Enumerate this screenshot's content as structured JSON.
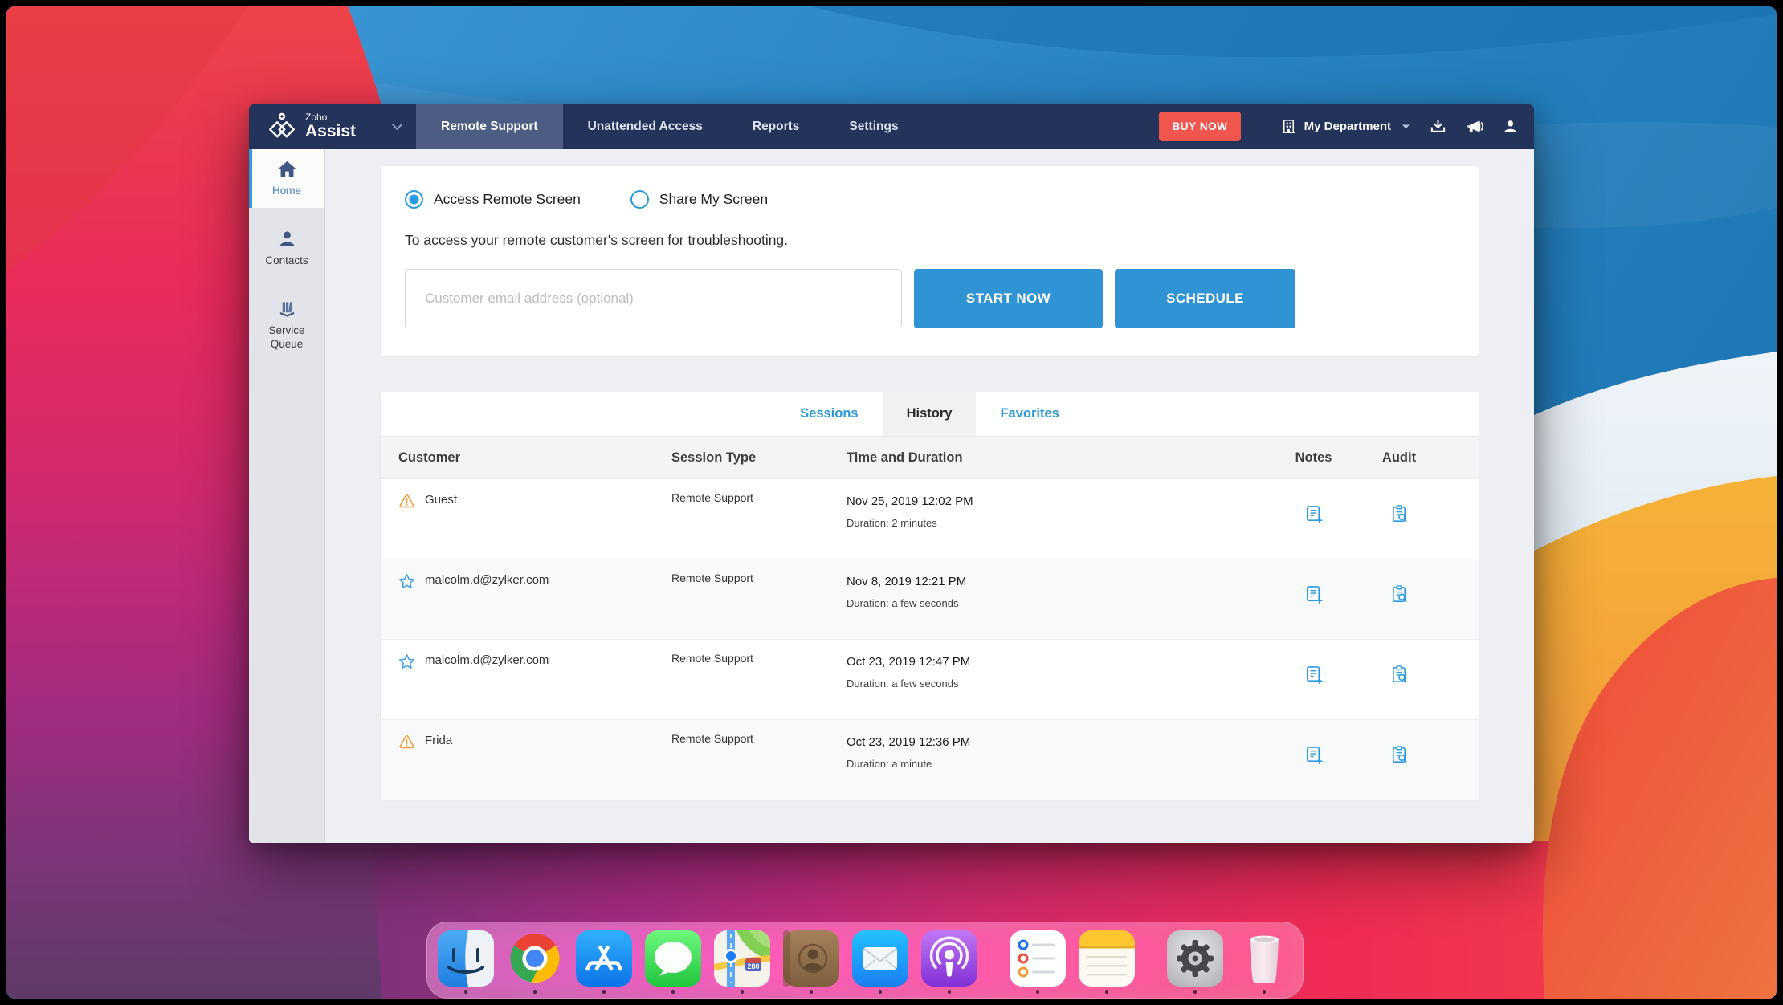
{
  "window": {
    "navbar": {
      "logo": {
        "zoho": "Zoho",
        "product": "Assist"
      },
      "tabs": [
        {
          "label": "Remote Support",
          "active": true
        },
        {
          "label": "Unattended Access",
          "active": false
        },
        {
          "label": "Reports",
          "active": false
        },
        {
          "label": "Settings",
          "active": false
        }
      ],
      "buy_now": "BUY NOW",
      "department": "My Department"
    },
    "sidebar": {
      "items": [
        {
          "label": "Home",
          "icon": "home-icon",
          "active": true
        },
        {
          "label": "Contacts",
          "icon": "contacts-icon",
          "active": false
        },
        {
          "label": "Service Queue",
          "icon": "service-queue-icon",
          "active": false
        }
      ]
    },
    "quick_action": {
      "radios": [
        {
          "label": "Access Remote Screen",
          "selected": true
        },
        {
          "label": "Share My Screen",
          "selected": false
        }
      ],
      "description": "To access your remote customer's screen for troubleshooting.",
      "email_placeholder": "Customer email address (optional)",
      "start_button": "START NOW",
      "schedule_button": "SCHEDULE"
    },
    "sessions": {
      "tabs": [
        {
          "label": "Sessions",
          "active": false
        },
        {
          "label": "History",
          "active": true
        },
        {
          "label": "Favorites",
          "active": false
        }
      ],
      "columns": [
        "Customer",
        "Session Type",
        "Time and Duration",
        "Notes",
        "Audit"
      ],
      "rows": [
        {
          "icon": "guest-alert-icon",
          "customer": "Guest",
          "session_type": "Remote Support",
          "time": "Nov 25, 2019 12:02 PM",
          "duration": "Duration: 2 minutes"
        },
        {
          "icon": "favorite-star-icon",
          "customer": "malcolm.d@zylker.com",
          "session_type": "Remote Support",
          "time": "Nov 8, 2019 12:21 PM",
          "duration": "Duration: a few seconds"
        },
        {
          "icon": "favorite-star-icon",
          "customer": "malcolm.d@zylker.com",
          "session_type": "Remote Support",
          "time": "Oct 23, 2019 12:47 PM",
          "duration": "Duration: a few seconds"
        },
        {
          "icon": "guest-alert-icon",
          "customer": "Frida",
          "session_type": "Remote Support",
          "time": "Oct 23, 2019 12:36 PM",
          "duration": "Duration: a minute"
        }
      ]
    }
  },
  "dock": {
    "apps": [
      "finder",
      "chrome",
      "app-store",
      "messages",
      "maps",
      "contacts",
      "mail",
      "podcasts",
      "reminders",
      "notes",
      "system-preferences",
      "trash"
    ],
    "maps_badge": "280"
  },
  "colors": {
    "accent_blue": "#2b9be0",
    "button_blue": "#3093d4",
    "navbar": "#24335a",
    "navbar_active_tab": "#4d5c82",
    "buy_now_red": "#f0554e",
    "alert_orange": "#f0a13e",
    "link_blue": "#2e9ad8"
  }
}
